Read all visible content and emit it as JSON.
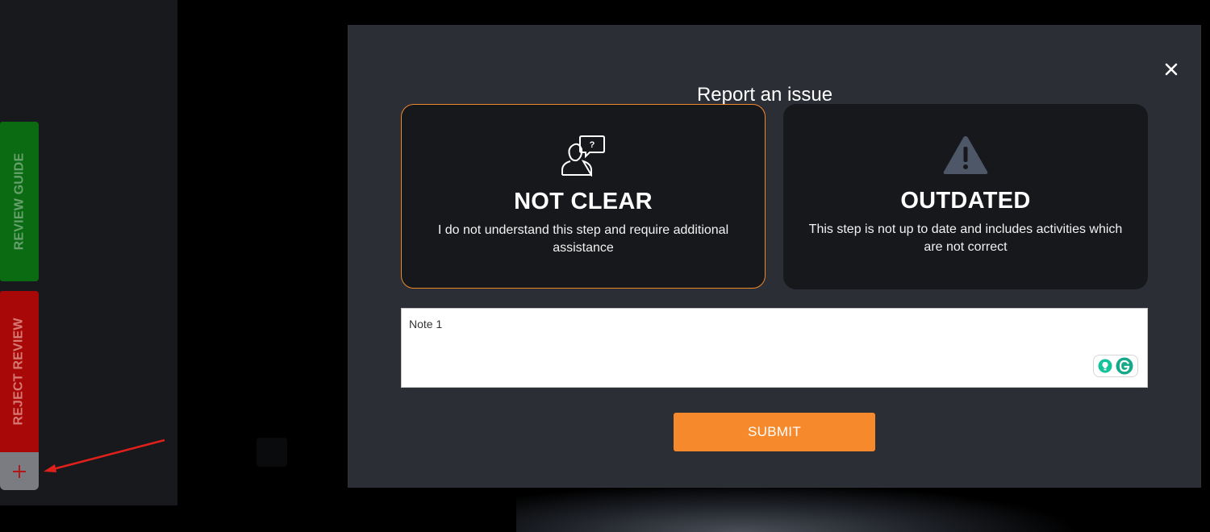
{
  "sidebar": {
    "review_guide_label": "REVIEW GUIDE",
    "reject_review_label": "REJECT REVIEW",
    "add_button_icon": "plus-icon",
    "colors": {
      "review_guide": "#0b6b13",
      "reject_review": "#a80908",
      "add_button": "#7a7c82"
    }
  },
  "annotation": {
    "arrow_color": "#e0201b",
    "arrow_icon": "red-arrow-annotation"
  },
  "modal": {
    "title": "Report an issue",
    "close_icon": "close-icon",
    "options": [
      {
        "id": "not-clear",
        "title": "NOT CLEAR",
        "description": "I do not understand this step and require additional assistance",
        "icon": "person-question-icon",
        "selected": true
      },
      {
        "id": "outdated",
        "title": "OUTDATED",
        "description": "This step is not up to date and includes activities which are not correct",
        "icon": "warning-triangle-icon",
        "selected": false
      }
    ],
    "note": {
      "value": "Note 1",
      "placeholder": ""
    },
    "submit_label": "SUBMIT",
    "colors": {
      "accent": "#f6892c",
      "modal_bg": "#2b2e35",
      "card_bg": "#17181c",
      "selected_border": "#f0892e"
    }
  }
}
